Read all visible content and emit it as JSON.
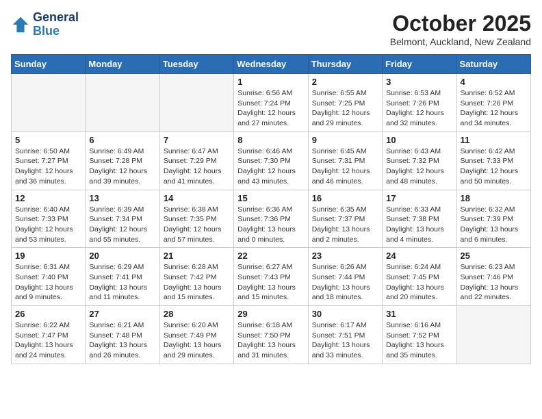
{
  "header": {
    "logo_line1": "General",
    "logo_line2": "Blue",
    "month": "October 2025",
    "location": "Belmont, Auckland, New Zealand"
  },
  "weekdays": [
    "Sunday",
    "Monday",
    "Tuesday",
    "Wednesday",
    "Thursday",
    "Friday",
    "Saturday"
  ],
  "weeks": [
    [
      {
        "day": "",
        "info": ""
      },
      {
        "day": "",
        "info": ""
      },
      {
        "day": "",
        "info": ""
      },
      {
        "day": "1",
        "info": "Sunrise: 6:56 AM\nSunset: 7:24 PM\nDaylight: 12 hours\nand 27 minutes."
      },
      {
        "day": "2",
        "info": "Sunrise: 6:55 AM\nSunset: 7:25 PM\nDaylight: 12 hours\nand 29 minutes."
      },
      {
        "day": "3",
        "info": "Sunrise: 6:53 AM\nSunset: 7:26 PM\nDaylight: 12 hours\nand 32 minutes."
      },
      {
        "day": "4",
        "info": "Sunrise: 6:52 AM\nSunset: 7:26 PM\nDaylight: 12 hours\nand 34 minutes."
      }
    ],
    [
      {
        "day": "5",
        "info": "Sunrise: 6:50 AM\nSunset: 7:27 PM\nDaylight: 12 hours\nand 36 minutes."
      },
      {
        "day": "6",
        "info": "Sunrise: 6:49 AM\nSunset: 7:28 PM\nDaylight: 12 hours\nand 39 minutes."
      },
      {
        "day": "7",
        "info": "Sunrise: 6:47 AM\nSunset: 7:29 PM\nDaylight: 12 hours\nand 41 minutes."
      },
      {
        "day": "8",
        "info": "Sunrise: 6:46 AM\nSunset: 7:30 PM\nDaylight: 12 hours\nand 43 minutes."
      },
      {
        "day": "9",
        "info": "Sunrise: 6:45 AM\nSunset: 7:31 PM\nDaylight: 12 hours\nand 46 minutes."
      },
      {
        "day": "10",
        "info": "Sunrise: 6:43 AM\nSunset: 7:32 PM\nDaylight: 12 hours\nand 48 minutes."
      },
      {
        "day": "11",
        "info": "Sunrise: 6:42 AM\nSunset: 7:33 PM\nDaylight: 12 hours\nand 50 minutes."
      }
    ],
    [
      {
        "day": "12",
        "info": "Sunrise: 6:40 AM\nSunset: 7:33 PM\nDaylight: 12 hours\nand 53 minutes."
      },
      {
        "day": "13",
        "info": "Sunrise: 6:39 AM\nSunset: 7:34 PM\nDaylight: 12 hours\nand 55 minutes."
      },
      {
        "day": "14",
        "info": "Sunrise: 6:38 AM\nSunset: 7:35 PM\nDaylight: 12 hours\nand 57 minutes."
      },
      {
        "day": "15",
        "info": "Sunrise: 6:36 AM\nSunset: 7:36 PM\nDaylight: 13 hours\nand 0 minutes."
      },
      {
        "day": "16",
        "info": "Sunrise: 6:35 AM\nSunset: 7:37 PM\nDaylight: 13 hours\nand 2 minutes."
      },
      {
        "day": "17",
        "info": "Sunrise: 6:33 AM\nSunset: 7:38 PM\nDaylight: 13 hours\nand 4 minutes."
      },
      {
        "day": "18",
        "info": "Sunrise: 6:32 AM\nSunset: 7:39 PM\nDaylight: 13 hours\nand 6 minutes."
      }
    ],
    [
      {
        "day": "19",
        "info": "Sunrise: 6:31 AM\nSunset: 7:40 PM\nDaylight: 13 hours\nand 9 minutes."
      },
      {
        "day": "20",
        "info": "Sunrise: 6:29 AM\nSunset: 7:41 PM\nDaylight: 13 hours\nand 11 minutes."
      },
      {
        "day": "21",
        "info": "Sunrise: 6:28 AM\nSunset: 7:42 PM\nDaylight: 13 hours\nand 15 minutes."
      },
      {
        "day": "22",
        "info": "Sunrise: 6:27 AM\nSunset: 7:43 PM\nDaylight: 13 hours\nand 15 minutes."
      },
      {
        "day": "23",
        "info": "Sunrise: 6:26 AM\nSunset: 7:44 PM\nDaylight: 13 hours\nand 18 minutes."
      },
      {
        "day": "24",
        "info": "Sunrise: 6:24 AM\nSunset: 7:45 PM\nDaylight: 13 hours\nand 20 minutes."
      },
      {
        "day": "25",
        "info": "Sunrise: 6:23 AM\nSunset: 7:46 PM\nDaylight: 13 hours\nand 22 minutes."
      }
    ],
    [
      {
        "day": "26",
        "info": "Sunrise: 6:22 AM\nSunset: 7:47 PM\nDaylight: 13 hours\nand 24 minutes."
      },
      {
        "day": "27",
        "info": "Sunrise: 6:21 AM\nSunset: 7:48 PM\nDaylight: 13 hours\nand 26 minutes."
      },
      {
        "day": "28",
        "info": "Sunrise: 6:20 AM\nSunset: 7:49 PM\nDaylight: 13 hours\nand 29 minutes."
      },
      {
        "day": "29",
        "info": "Sunrise: 6:18 AM\nSunset: 7:50 PM\nDaylight: 13 hours\nand 31 minutes."
      },
      {
        "day": "30",
        "info": "Sunrise: 6:17 AM\nSunset: 7:51 PM\nDaylight: 13 hours\nand 33 minutes."
      },
      {
        "day": "31",
        "info": "Sunrise: 6:16 AM\nSunset: 7:52 PM\nDaylight: 13 hours\nand 35 minutes."
      },
      {
        "day": "",
        "info": ""
      }
    ]
  ]
}
